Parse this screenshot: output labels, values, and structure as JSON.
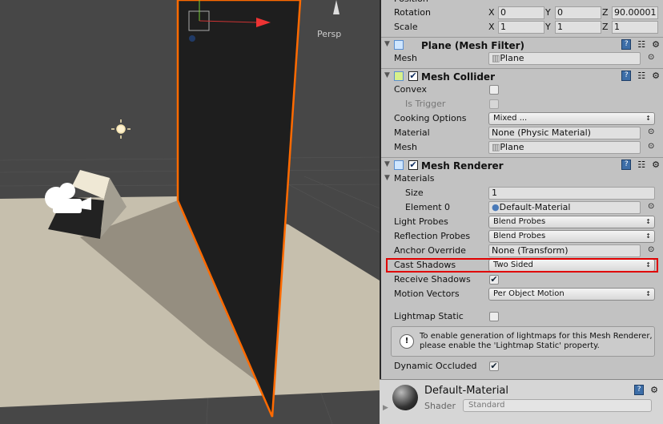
{
  "scene": {
    "view_label": "Persp",
    "selection_color": "#ff6a00"
  },
  "inspector": {
    "transform": {
      "position_label": "Position",
      "rotation": {
        "label": "Rotation",
        "x": "0",
        "y": "0",
        "z": "90.00001"
      },
      "scale": {
        "label": "Scale",
        "x": "1",
        "y": "1",
        "z": "1"
      }
    },
    "mesh_filter": {
      "title": "Plane (Mesh Filter)",
      "mesh_label": "Mesh",
      "mesh_value": "Plane"
    },
    "mesh_collider": {
      "title": "Mesh Collider",
      "enabled": true,
      "convex_label": "Convex",
      "convex": false,
      "is_trigger_label": "Is Trigger",
      "is_trigger": false,
      "cooking_label": "Cooking Options",
      "cooking_value": "Mixed ...",
      "material_label": "Material",
      "material_value": "None (Physic Material)",
      "mesh_label": "Mesh",
      "mesh_value": "Plane"
    },
    "mesh_renderer": {
      "title": "Mesh Renderer",
      "enabled": true,
      "materials_label": "Materials",
      "size_label": "Size",
      "size_value": "1",
      "element0_label": "Element 0",
      "element0_value": "Default-Material",
      "light_probes_label": "Light Probes",
      "light_probes_value": "Blend Probes",
      "reflection_probes_label": "Reflection Probes",
      "reflection_probes_value": "Blend Probes",
      "anchor_label": "Anchor Override",
      "anchor_value": "None (Transform)",
      "cast_shadows_label": "Cast Shadows",
      "cast_shadows_value": "Two Sided",
      "receive_shadows_label": "Receive Shadows",
      "receive_shadows": true,
      "motion_vectors_label": "Motion Vectors",
      "motion_vectors_value": "Per Object Motion",
      "lightmap_static_label": "Lightmap Static",
      "lightmap_static": false,
      "help_line1": "To enable generation of lightmaps for this Mesh Renderer,",
      "help_line2": "please enable the 'Lightmap Static' property.",
      "dynamic_occluded_label": "Dynamic Occluded",
      "dynamic_occluded": true
    },
    "material": {
      "name": "Default-Material",
      "shader_label": "Shader",
      "shader_value": "Standard"
    },
    "highlight_color": "#e00000"
  }
}
